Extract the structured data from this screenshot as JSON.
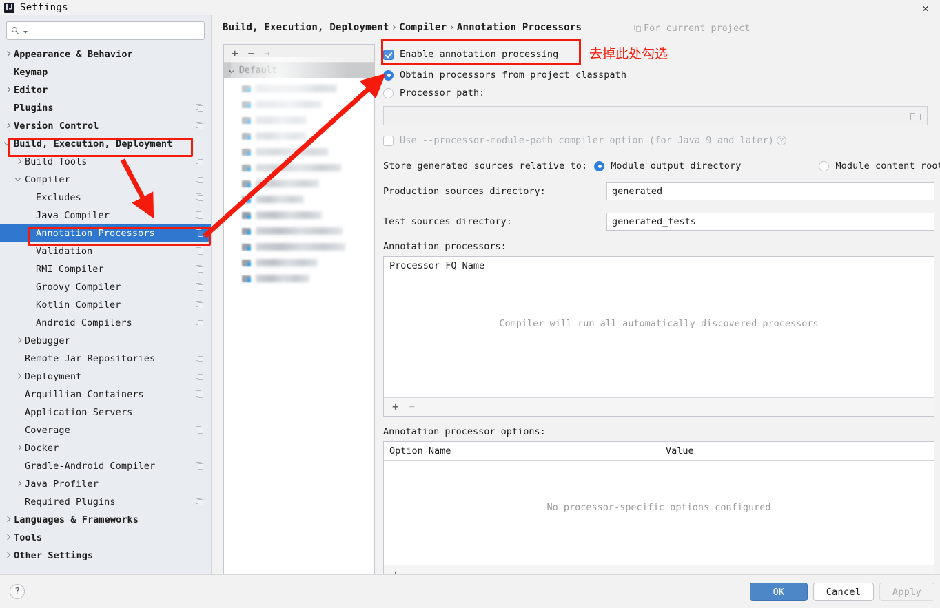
{
  "window": {
    "title": "Settings",
    "app_icon": "intellij-idea-icon",
    "close_icon": "close-icon"
  },
  "sidebar": {
    "search": {
      "placeholder": "",
      "value": "",
      "icon": "search-icon"
    },
    "items": [
      {
        "label": "Appearance & Behavior",
        "indent": 0,
        "twisty": "collapsed",
        "bold": true,
        "copy": false,
        "selected": false
      },
      {
        "label": "Keymap",
        "indent": 0,
        "twisty": "none",
        "bold": true,
        "copy": false,
        "selected": false
      },
      {
        "label": "Editor",
        "indent": 0,
        "twisty": "collapsed",
        "bold": true,
        "copy": false,
        "selected": false
      },
      {
        "label": "Plugins",
        "indent": 0,
        "twisty": "none",
        "bold": true,
        "copy": true,
        "selected": false
      },
      {
        "label": "Version Control",
        "indent": 0,
        "twisty": "collapsed",
        "bold": true,
        "copy": true,
        "selected": false
      },
      {
        "label": "Build, Execution, Deployment",
        "indent": 0,
        "twisty": "expanded",
        "bold": true,
        "copy": false,
        "selected": false
      },
      {
        "label": "Build Tools",
        "indent": 1,
        "twisty": "collapsed",
        "bold": false,
        "copy": true,
        "selected": false
      },
      {
        "label": "Compiler",
        "indent": 1,
        "twisty": "expanded",
        "bold": false,
        "copy": true,
        "selected": false
      },
      {
        "label": "Excludes",
        "indent": 2,
        "twisty": "none",
        "bold": false,
        "copy": true,
        "selected": false
      },
      {
        "label": "Java Compiler",
        "indent": 2,
        "twisty": "none",
        "bold": false,
        "copy": true,
        "selected": false
      },
      {
        "label": "Annotation Processors",
        "indent": 2,
        "twisty": "none",
        "bold": false,
        "copy": true,
        "selected": true
      },
      {
        "label": "Validation",
        "indent": 2,
        "twisty": "none",
        "bold": false,
        "copy": true,
        "selected": false
      },
      {
        "label": "RMI Compiler",
        "indent": 2,
        "twisty": "none",
        "bold": false,
        "copy": true,
        "selected": false
      },
      {
        "label": "Groovy Compiler",
        "indent": 2,
        "twisty": "none",
        "bold": false,
        "copy": true,
        "selected": false
      },
      {
        "label": "Kotlin Compiler",
        "indent": 2,
        "twisty": "none",
        "bold": false,
        "copy": true,
        "selected": false
      },
      {
        "label": "Android Compilers",
        "indent": 2,
        "twisty": "none",
        "bold": false,
        "copy": true,
        "selected": false
      },
      {
        "label": "Debugger",
        "indent": 1,
        "twisty": "collapsed",
        "bold": false,
        "copy": false,
        "selected": false
      },
      {
        "label": "Remote Jar Repositories",
        "indent": 1,
        "twisty": "none",
        "bold": false,
        "copy": true,
        "selected": false
      },
      {
        "label": "Deployment",
        "indent": 1,
        "twisty": "collapsed",
        "bold": false,
        "copy": true,
        "selected": false
      },
      {
        "label": "Arquillian Containers",
        "indent": 1,
        "twisty": "none",
        "bold": false,
        "copy": true,
        "selected": false
      },
      {
        "label": "Application Servers",
        "indent": 1,
        "twisty": "none",
        "bold": false,
        "copy": false,
        "selected": false
      },
      {
        "label": "Coverage",
        "indent": 1,
        "twisty": "none",
        "bold": false,
        "copy": true,
        "selected": false
      },
      {
        "label": "Docker",
        "indent": 1,
        "twisty": "collapsed",
        "bold": false,
        "copy": false,
        "selected": false
      },
      {
        "label": "Gradle-Android Compiler",
        "indent": 1,
        "twisty": "none",
        "bold": false,
        "copy": true,
        "selected": false
      },
      {
        "label": "Java Profiler",
        "indent": 1,
        "twisty": "collapsed",
        "bold": false,
        "copy": false,
        "selected": false
      },
      {
        "label": "Required Plugins",
        "indent": 1,
        "twisty": "none",
        "bold": false,
        "copy": true,
        "selected": false
      },
      {
        "label": "Languages & Frameworks",
        "indent": 0,
        "twisty": "collapsed",
        "bold": true,
        "copy": false,
        "selected": false
      },
      {
        "label": "Tools",
        "indent": 0,
        "twisty": "collapsed",
        "bold": true,
        "copy": false,
        "selected": false
      },
      {
        "label": "Other Settings",
        "indent": 0,
        "twisty": "collapsed",
        "bold": true,
        "copy": false,
        "selected": false
      }
    ]
  },
  "main": {
    "breadcrumb": {
      "part1": "Build, Execution, Deployment",
      "part2": "Compiler",
      "part3": "Annotation Processors",
      "separator": "›"
    },
    "scope_hint": {
      "label": "For current project",
      "icon": "copy-icon"
    },
    "module_panel": {
      "toolbar": {
        "add": "+",
        "remove": "−",
        "move": "→"
      },
      "group_label": "Default",
      "redacted_rows": 13
    },
    "enable_annotation_processing": {
      "label": "Enable annotation processing",
      "checked": true
    },
    "processor_source": {
      "option_classpath": {
        "label": "Obtain processors from project classpath",
        "selected": true
      },
      "option_path": {
        "label": "Processor path:",
        "selected": false
      },
      "path_value": "",
      "browse_icon": "folder-icon"
    },
    "module_path_option": {
      "label": "Use --processor-module-path compiler option (for Java 9 and later)",
      "checked": false,
      "disabled": true,
      "help_icon": "question-mark-icon"
    },
    "store_generated": {
      "label": "Store generated sources relative to:",
      "option_output": {
        "label": "Module output directory",
        "selected": true
      },
      "option_content": {
        "label": "Module content root",
        "selected": false
      }
    },
    "production_sources": {
      "label": "Production sources directory:",
      "value": "generated"
    },
    "test_sources": {
      "label": "Test sources directory:",
      "value": "generated_tests"
    },
    "processors_table": {
      "section_label": "Annotation processors:",
      "columns": [
        "Processor FQ Name"
      ],
      "empty_message": "Compiler will run all automatically discovered processors",
      "rows": [],
      "footer": {
        "add": "+",
        "remove": "−"
      }
    },
    "options_table": {
      "section_label": "Annotation processor options:",
      "columns": [
        "Option Name",
        "Value"
      ],
      "empty_message": "No processor-specific options configured",
      "rows": [],
      "footer": {
        "add": "+",
        "remove": "−"
      }
    }
  },
  "footer": {
    "help_label": "?",
    "ok_label": "OK",
    "cancel_label": "Cancel",
    "apply_label": "Apply"
  },
  "annotations": {
    "note_text": "去掉此处勾选",
    "color": "#f51b0c"
  }
}
